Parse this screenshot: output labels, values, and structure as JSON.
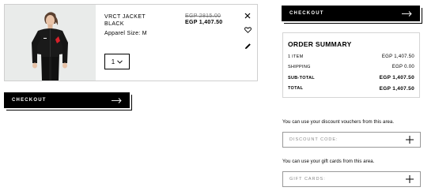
{
  "cart": {
    "item": {
      "name_line1": "VRCT JACKET",
      "name_line2": "BLACK",
      "size_label": "Apparel Size: M",
      "price_old": "EGP 2815.00",
      "price_new": "EGP 1,407.50",
      "quantity": "1"
    }
  },
  "checkout": {
    "label": "CHECKOUT"
  },
  "summary": {
    "title": "ORDER SUMMARY",
    "rows": [
      {
        "label": "1 ITEM",
        "value": "EGP 1,407.50"
      },
      {
        "label": "SHIPPING",
        "value": "EGP 0.00"
      },
      {
        "label": "SUB-TOTAL",
        "value": "EGP 1,407.50"
      },
      {
        "label": "TOTAL",
        "value": "EGP 1,407.50"
      }
    ]
  },
  "discount": {
    "text": "You can use your discount vouchers from this area.",
    "field_label": "DISCOUNT CODE:"
  },
  "giftcard": {
    "text": "You can use your gift cards from this area.",
    "field_label": "GIFT CARDS:"
  },
  "icons": [
    "close-icon",
    "heart-icon",
    "pencil-icon",
    "chevron-down-icon",
    "arrow-right-icon",
    "plus-icon"
  ]
}
